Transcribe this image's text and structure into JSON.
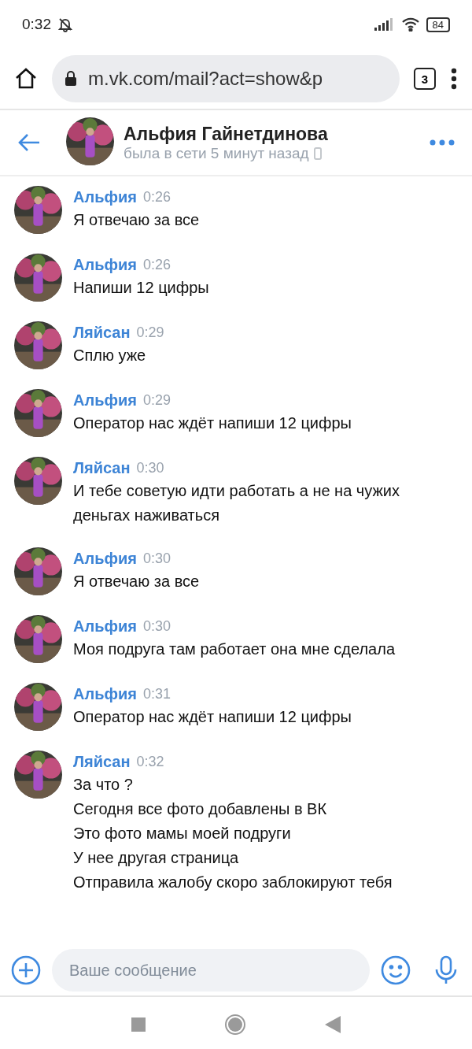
{
  "status_bar": {
    "time": "0:32",
    "battery": "84"
  },
  "browser": {
    "url": "m.vk.com/mail?act=show&p",
    "tab_count": "3"
  },
  "header": {
    "name": "Альфия Гайнетдинова",
    "status": "была в сети 5 минут назад"
  },
  "messages": [
    {
      "author": "Альфия",
      "time": "0:26",
      "lines": [
        "Я отвечаю за все"
      ]
    },
    {
      "author": "Альфия",
      "time": "0:26",
      "lines": [
        "Напиши 12 цифры"
      ]
    },
    {
      "author": "Ляйсан",
      "time": "0:29",
      "lines": [
        "Сплю уже"
      ]
    },
    {
      "author": "Альфия",
      "time": "0:29",
      "lines": [
        "Оператор нас ждёт напиши 12 цифры"
      ]
    },
    {
      "author": "Ляйсан",
      "time": "0:30",
      "lines": [
        "И тебе советую идти работать а не на чужих деньгах наживаться"
      ]
    },
    {
      "author": "Альфия",
      "time": "0:30",
      "lines": [
        "Я отвечаю за все"
      ]
    },
    {
      "author": "Альфия",
      "time": "0:30",
      "lines": [
        "Моя подруга там работает она мне сделала"
      ]
    },
    {
      "author": "Альфия",
      "time": "0:31",
      "lines": [
        "Оператор нас ждёт напиши 12 цифры"
      ]
    },
    {
      "author": "Ляйсан",
      "time": "0:32",
      "lines": [
        "За что ?",
        "Сегодня все фото добавлены в ВК",
        "Это фото мамы моей подруги",
        "У нее другая страница",
        "Отправила жалобу скоро заблокируют тебя"
      ]
    }
  ],
  "composer": {
    "placeholder": "Ваше сообщение"
  }
}
